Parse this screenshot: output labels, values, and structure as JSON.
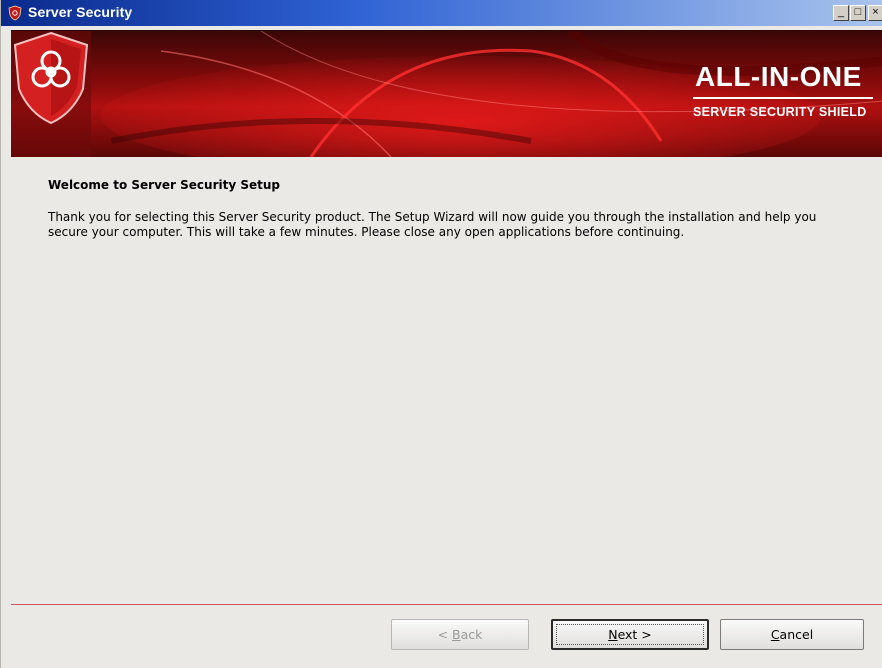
{
  "window": {
    "title": "Server Security",
    "controls": {
      "minimize": "_",
      "maximize": "□",
      "close": "×"
    }
  },
  "banner": {
    "brand_line1": "ALL-IN-ONE",
    "brand_line2": "SERVER SECURITY SHIELD",
    "logo_icon": "biohazard-shield-icon"
  },
  "content": {
    "heading": "Welcome to Server Security Setup",
    "body": "Thank you for selecting this Server Security product. The Setup Wizard will now guide you through the installation and help you secure your computer. This will take a few minutes. Please close any open applications before continuing."
  },
  "buttons": {
    "back": {
      "mnemonic": "< ",
      "underlined": "B",
      "rest": "ack",
      "enabled": false
    },
    "next": {
      "underlined": "N",
      "rest": "ext >",
      "enabled": true
    },
    "cancel": {
      "underlined": "C",
      "rest": "ancel",
      "enabled": true
    }
  },
  "colors": {
    "titlebar_start": "#0a2a8c",
    "titlebar_end": "#a9c4ec",
    "banner_red": "#b01010",
    "divider": "#c65a5a",
    "background": "#ebe9e6"
  }
}
